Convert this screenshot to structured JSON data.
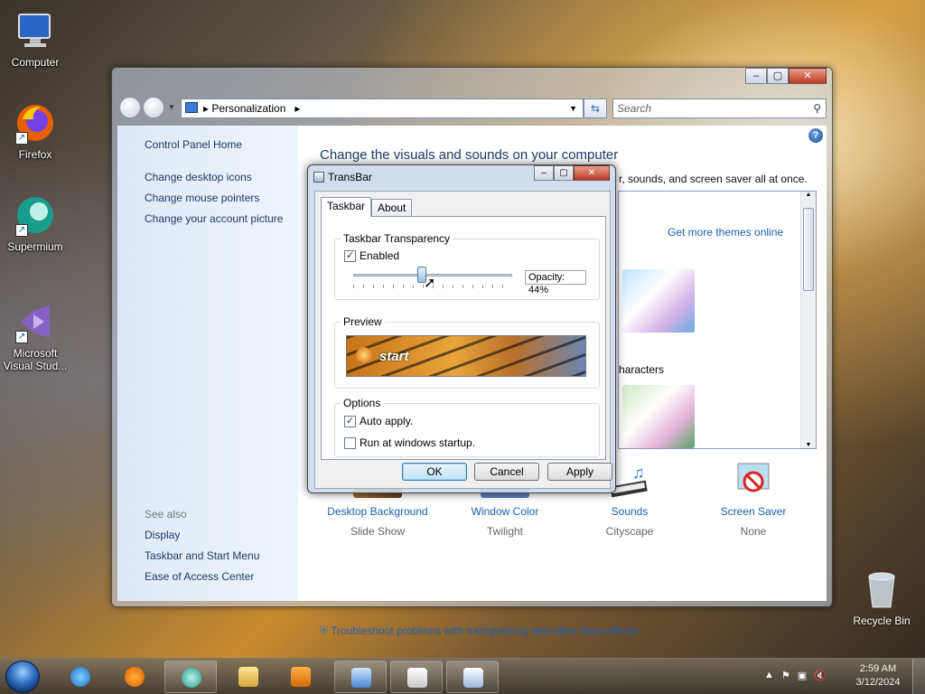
{
  "desktop": {
    "icons": [
      {
        "label": "Computer"
      },
      {
        "label": "Firefox"
      },
      {
        "label": "Supermium"
      },
      {
        "label": "Microsoft Visual Stud..."
      }
    ],
    "recycle_bin": "Recycle Bin"
  },
  "main_window": {
    "breadcrumb": "Personalization",
    "search_placeholder": "Search",
    "left_pane": {
      "home": "Control Panel Home",
      "links": [
        "Change desktop icons",
        "Change mouse pointers",
        "Change your account picture"
      ],
      "see_also_label": "See also",
      "see_also": [
        "Display",
        "Taskbar and Start Menu",
        "Ease of Access Center"
      ]
    },
    "title": "Change the visuals and sounds on your computer",
    "description_fragment": "r, sounds, and screen saver all at once.",
    "themes": {
      "get_more": "Get more themes online",
      "characters_label": "haracters"
    },
    "customizations": [
      {
        "title": "Desktop Background",
        "sub": "Slide Show"
      },
      {
        "title": "Window Color",
        "sub": "Twilight"
      },
      {
        "title": "Sounds",
        "sub": "Cityscape"
      },
      {
        "title": "Screen Saver",
        "sub": "None"
      }
    ],
    "troubleshoot": "Troubleshoot problems with transparency and other Aero effects"
  },
  "transbar": {
    "title": "TransBar",
    "tabs": [
      "Taskbar",
      "About"
    ],
    "transparency_group": "Taskbar Transparency",
    "enabled_label": "Enabled",
    "enabled": true,
    "opacity_text": "Opacity: 44%",
    "opacity_value": 44,
    "preview_group": "Preview",
    "preview_start": "start",
    "options_group": "Options",
    "auto_apply_label": "Auto apply.",
    "auto_apply": true,
    "run_startup_label": "Run at windows startup.",
    "run_startup": false,
    "buttons": {
      "ok": "OK",
      "cancel": "Cancel",
      "apply": "Apply"
    }
  },
  "taskbar": {
    "time": "2:59 AM",
    "date": "3/12/2024"
  }
}
